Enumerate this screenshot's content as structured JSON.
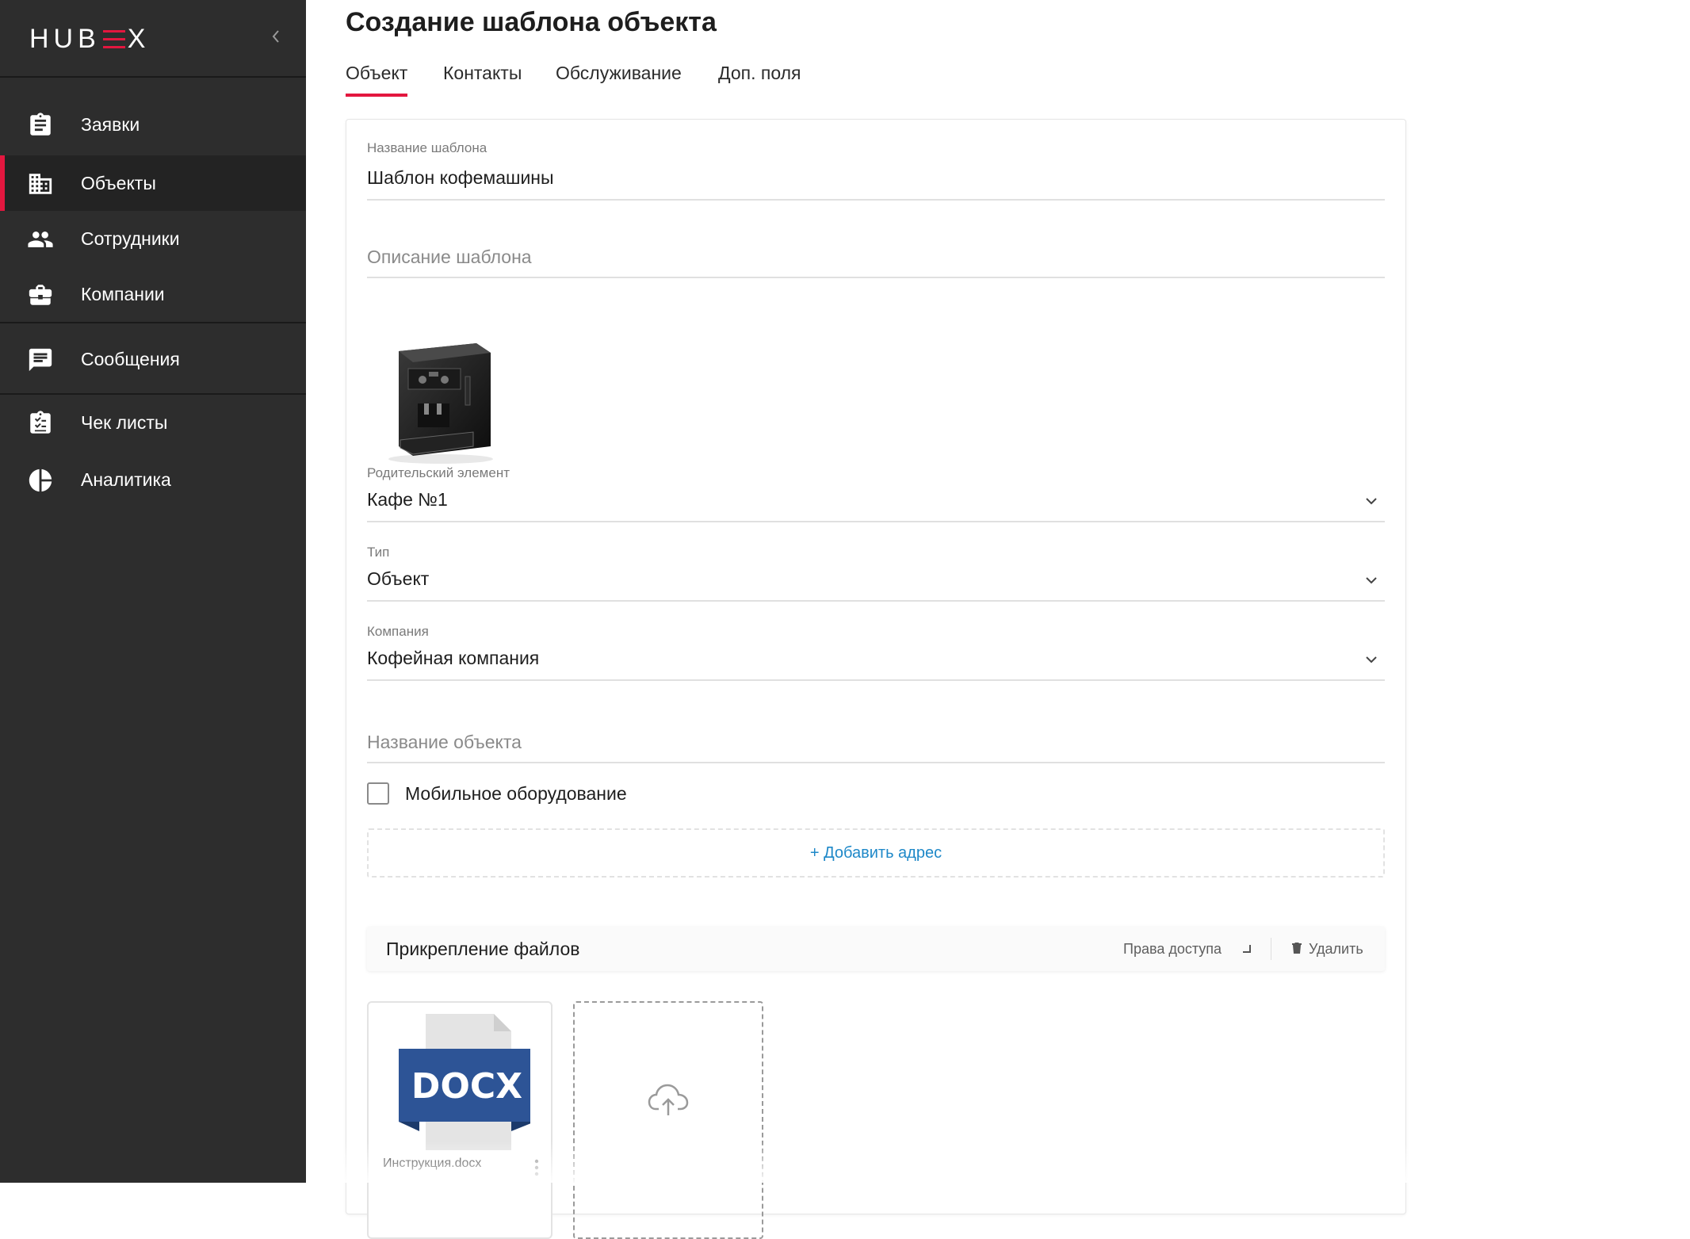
{
  "app": {
    "logo_text_left": "HUB",
    "logo_text_right": "X",
    "brand_color": "#e3173f",
    "sidebar_bg": "#2d2d2d"
  },
  "sidebar": {
    "collapse_icon": "chevron-left-icon",
    "items": [
      {
        "label": "Заявки",
        "icon": "clipboard-icon"
      },
      {
        "label": "Объекты",
        "icon": "buildings-icon",
        "active": true
      },
      {
        "label": "Сотрудники",
        "icon": "people-icon"
      },
      {
        "label": "Компании",
        "icon": "briefcase-icon"
      },
      {
        "label": "Сообщения",
        "icon": "chat-icon"
      },
      {
        "label": "Чек листы",
        "icon": "checklist-icon"
      },
      {
        "label": "Аналитика",
        "icon": "pie-chart-icon"
      }
    ]
  },
  "page": {
    "title": "Создание шаблона объекта"
  },
  "tabs": [
    {
      "label": "Объект",
      "active": true
    },
    {
      "label": "Контакты"
    },
    {
      "label": "Обслуживание"
    },
    {
      "label": "Доп. поля"
    }
  ],
  "form": {
    "template_name": {
      "label": "Название шаблона",
      "value": "Шаблон кофемашины"
    },
    "template_description": {
      "placeholder": "Описание шаблона"
    },
    "image": {
      "alt": "coffee-machine-image"
    },
    "parent": {
      "label": "Родительский элемент",
      "value": "Кафе №1"
    },
    "type": {
      "label": "Тип",
      "value": "Объект"
    },
    "company": {
      "label": "Компания",
      "value": "Кофейная компания"
    },
    "object_name": {
      "placeholder": "Название объекта"
    },
    "mobile_equipment": {
      "label": "Мобильное оборудование",
      "checked": false
    },
    "add_address": {
      "label": "+ Добавить адрес"
    }
  },
  "attachments": {
    "title": "Прикрепление файлов",
    "rights_label": "Права доступа",
    "delete_label": "Удалить",
    "files": [
      {
        "name": "Инструкция.docx",
        "badge": "DOCX",
        "badge_color": "#2d5496"
      }
    ],
    "upload_icon": "cloud-upload-icon"
  }
}
